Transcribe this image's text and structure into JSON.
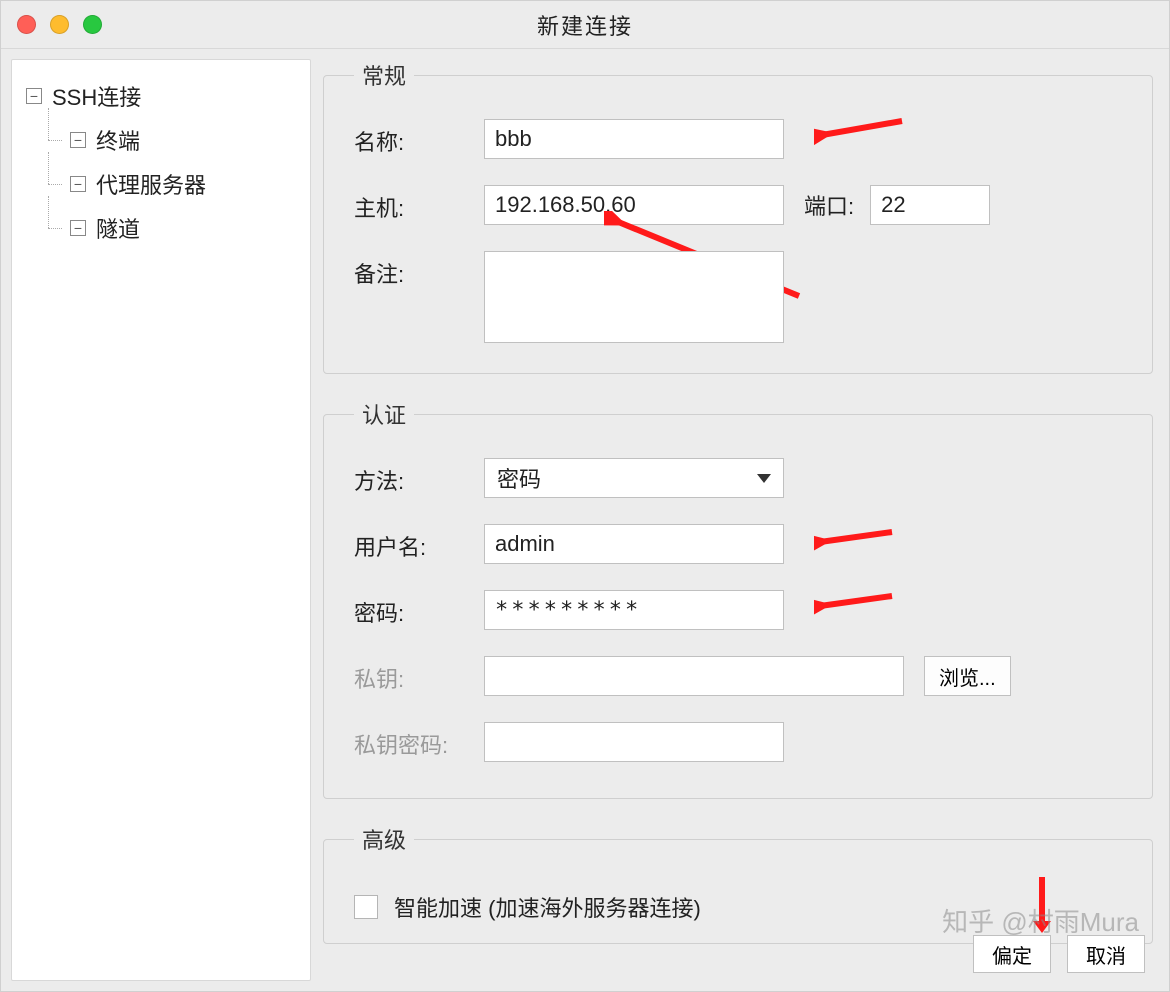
{
  "window": {
    "title": "新建连接"
  },
  "sidebar": {
    "root": "SSH连接",
    "items": [
      "终端",
      "代理服务器",
      "隧道"
    ]
  },
  "panels": {
    "general": {
      "legend": "常规",
      "name_label": "名称:",
      "name_value": "bbb",
      "host_label": "主机:",
      "host_value": "192.168.50.60",
      "port_label": "端口:",
      "port_value": "22",
      "remark_label": "备注:",
      "remark_value": ""
    },
    "auth": {
      "legend": "认证",
      "method_label": "方法:",
      "method_value": "密码",
      "user_label": "用户名:",
      "user_value": "admin",
      "pass_label": "密码:",
      "pass_value": "*********",
      "key_label": "私钥:",
      "key_value": "",
      "keypass_label": "私钥密码:",
      "keypass_value": "",
      "browse_label": "浏览..."
    },
    "advanced": {
      "legend": "高级",
      "accel_label": "智能加速 (加速海外服务器连接)"
    }
  },
  "buttons": {
    "ok": "偏定",
    "cancel": "取消"
  },
  "watermark": "知乎 @村雨Mura"
}
